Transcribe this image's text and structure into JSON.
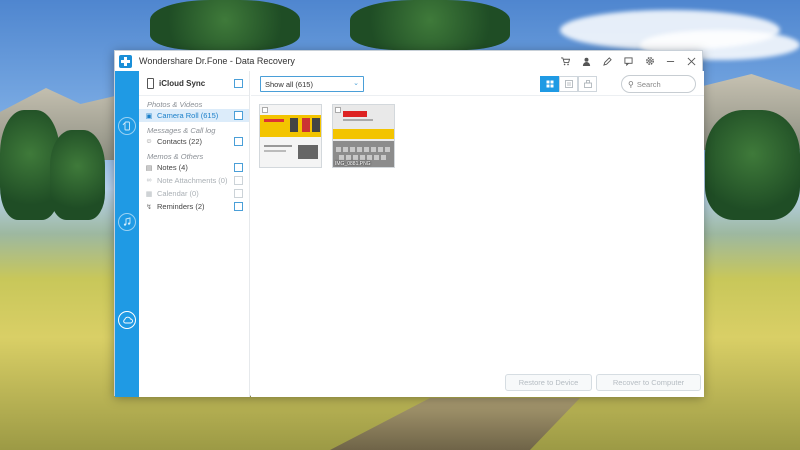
{
  "window": {
    "title": "Wondershare Dr.Fone - Data Recovery",
    "titlebar_buttons": [
      "cart-icon",
      "user-icon",
      "edit-icon",
      "feedback-icon",
      "settings-icon",
      "minimize-icon",
      "close-icon"
    ]
  },
  "side_strip": {
    "icons": [
      "restore-device-icon",
      "restore-itunes-icon",
      "restore-icloud-icon"
    ],
    "active": "restore-icloud-icon"
  },
  "categories": {
    "header": "iCloud Sync",
    "groups": [
      {
        "title": "Photos & Videos",
        "items": [
          {
            "label": "Camera Roll (615)",
            "selected": true,
            "disabled": false
          }
        ]
      },
      {
        "title": "Messages & Call log",
        "items": [
          {
            "label": "Contacts (22)",
            "selected": false,
            "disabled": false
          }
        ]
      },
      {
        "title": "Memos & Others",
        "items": [
          {
            "label": "Notes (4)",
            "selected": false,
            "disabled": false
          },
          {
            "label": "Note Attachments (0)",
            "selected": false,
            "disabled": true
          },
          {
            "label": "Calendar (0)",
            "selected": false,
            "disabled": true
          },
          {
            "label": "Reminders (2)",
            "selected": false,
            "disabled": false
          }
        ]
      }
    ]
  },
  "main": {
    "filter": "Show all (615)",
    "view_modes": [
      "grid-view-icon",
      "list-view-icon",
      "detail-view-icon"
    ],
    "active_view": "grid-view-icon",
    "search_placeholder": "Search",
    "thumbnails": [
      {
        "caption": ""
      },
      {
        "caption": "IMG_0881.PNG"
      }
    ],
    "buttons": {
      "restore_device": "Restore to Device",
      "recover_computer": "Recover to Computer"
    }
  },
  "colors": {
    "accent": "#1f9ae4",
    "selected_bg": "#dcecfa"
  }
}
